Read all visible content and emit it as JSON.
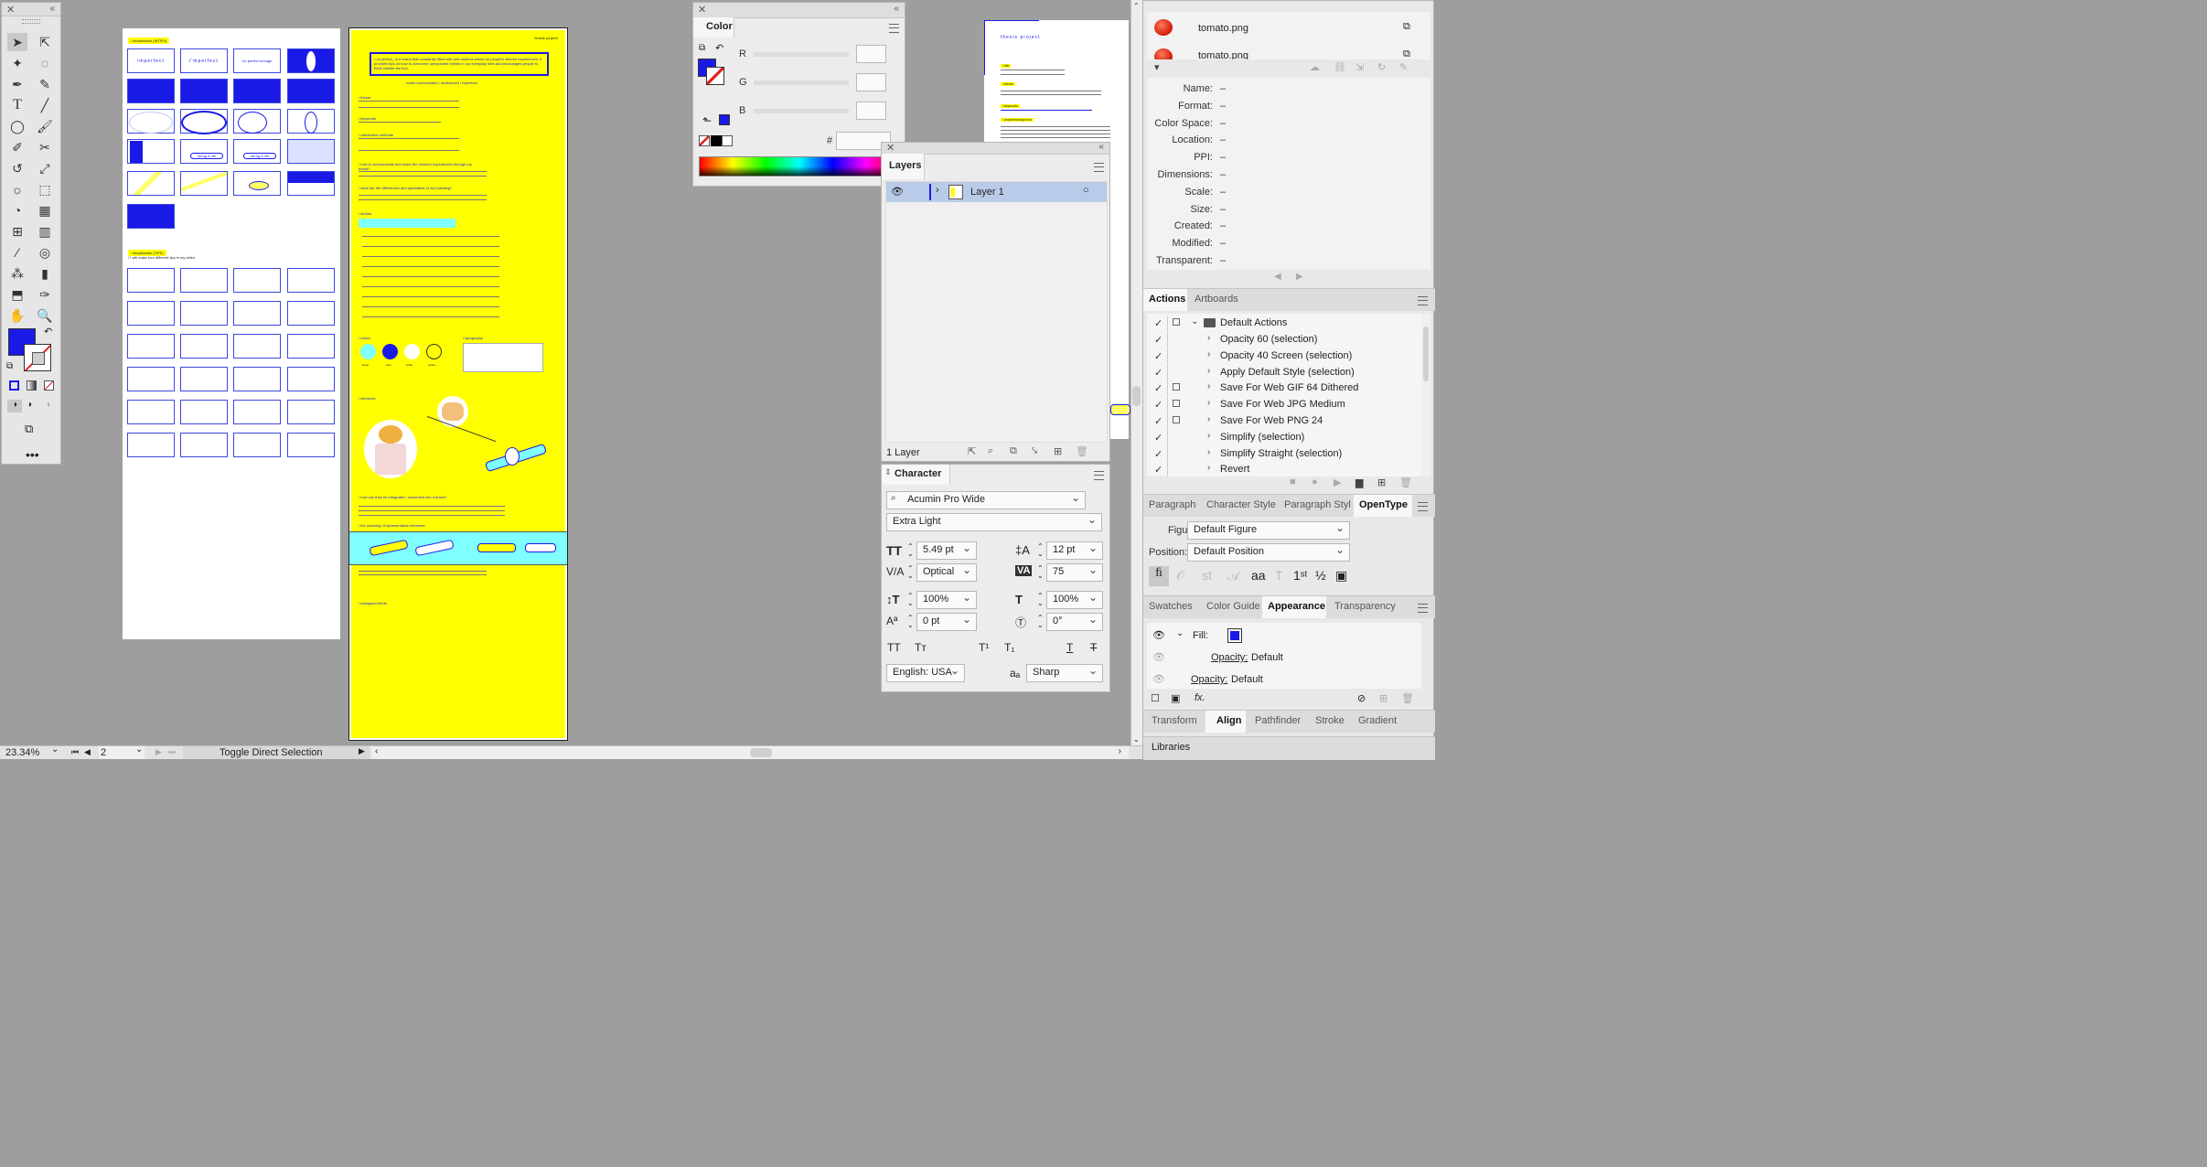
{
  "status": {
    "zoom": "23.34%",
    "artboard_num": "2",
    "status_text": "Toggle Direct Selection"
  },
  "colors": {
    "canvas": "#9e9e9e",
    "panel": "#ececec",
    "fill": "#1a1ae6",
    "yellow": "#ffff00",
    "cyan": "#7fffff"
  },
  "artboard1": {
    "heading1": "/ storyboards (INTRO)",
    "heading2": "/ storyboards (TIPS)",
    "heading2b": "/ I will make four different tips in my video",
    "t1": "imperfect",
    "t2": "i'mperfect",
    "t3": "i'm perfect enough",
    "shrug": "shrug it off!"
  },
  "artboard2": {
    "header": "/thesis project/",
    "brand_intro": "i_m perfect_ is a brand that constantly filled with new motions based on people's diverse experiences. It provides tips on how to overcome unexpected events in our everyday lives and encourages people to think outside the box.",
    "subhead": "motion communication / development / experience",
    "s_theme": "/ theme",
    "s_keywords": "/ keywords",
    "s_deliverable": "/ deliverable methods",
    "s_communicate": "/ how to communicate and share the viewer's experiences through my brand?",
    "s_differences": "/ what are the differences and specialties of my branding?",
    "s_stories": "/ stories",
    "s_colors": "/ colors",
    "s_typography": "/ typography",
    "s_elements": "/ elements",
    "s_integrated": "/ how can they be integrated / connected into a brand?",
    "s_meaning": "/ the meaning of representative elements",
    "s_instagram": "/ instagram feeds",
    "color_labels": [
      "linear",
      "blue",
      "white",
      "yellow"
    ]
  },
  "artboard3": {
    "title": "thesis project",
    "lines": [
      "/ title",
      "/ theme",
      "/ keywords",
      "/ project background"
    ]
  },
  "color_panel": {
    "title": "Color",
    "r": "R",
    "g": "G",
    "b": "B",
    "hash": "#"
  },
  "layers_panel": {
    "title": "Layers",
    "layer_name": "Layer 1",
    "footer": "1 Layer"
  },
  "character_panel": {
    "title": "Character",
    "font_family": "Acumin Pro Wide",
    "font_style": "Extra Light",
    "font_size": "5.49 pt",
    "leading": "12 pt",
    "kerning": "Optical",
    "tracking": "75",
    "vscale": "100%",
    "hscale": "100%",
    "baseline": "0 pt",
    "rotation": "0°",
    "language": "English: USA",
    "antialias": "Sharp",
    "aa_label": "aₐ"
  },
  "links_panel": {
    "files": [
      "tomato.png",
      "tomato.png"
    ],
    "info_labels": [
      "Name:",
      "Format:",
      "Color Space:",
      "Location:",
      "PPI:",
      "Dimensions:",
      "Scale:",
      "Size:",
      "Created:",
      "Modified:",
      "Transparent:"
    ],
    "info_value": "–"
  },
  "actions_panel": {
    "tabs": [
      "Actions",
      "Artboards"
    ],
    "set_name": "Default Actions",
    "items": [
      "Opacity 60 (selection)",
      "Opacity 40 Screen (selection)",
      "Apply Default Style (selection)",
      "Save For Web GIF 64 Dithered",
      "Save For Web JPG Medium",
      "Save For Web PNG 24",
      "Simplify (selection)",
      "Simplify Straight (selection)",
      "Revert"
    ]
  },
  "opentype_panel": {
    "tabs": [
      "Paragraph",
      "Character Style",
      "Paragraph Styl",
      "OpenType"
    ],
    "figure_label": "Figure:",
    "figure_value": "Default Figure",
    "position_label": "Position:",
    "position_value": "Default Position"
  },
  "appearance_panel": {
    "tabs": [
      "Swatches",
      "Color Guide",
      "Appearance",
      "Transparency"
    ],
    "fill_label": "Fill:",
    "opacity_label": "Opacity:",
    "opacity_value": "Default",
    "fx": "fx."
  },
  "bottom_tabs": {
    "tabs": [
      "Transform",
      "Align",
      "Pathfinder",
      "Stroke",
      "Gradient"
    ],
    "libraries": "Libraries"
  }
}
